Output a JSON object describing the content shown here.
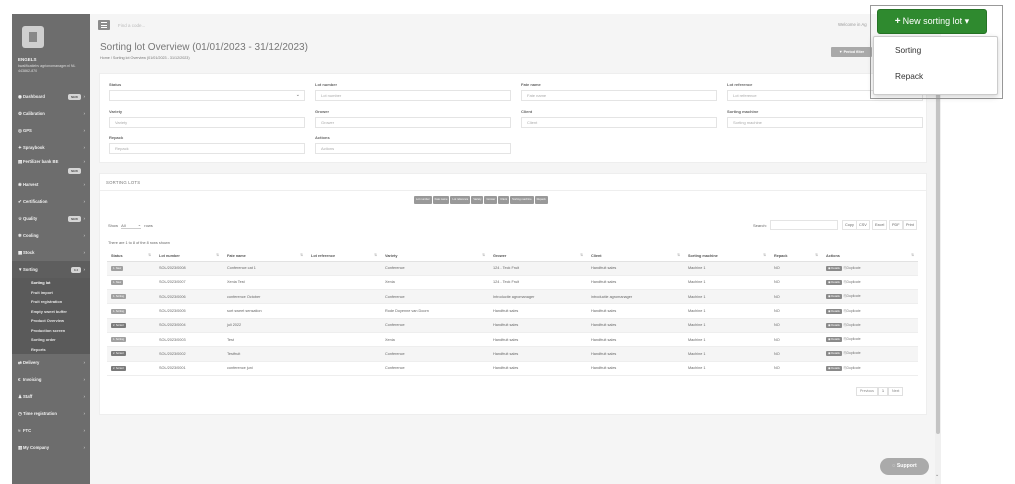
{
  "topbar": {
    "find_placeholder": "Find a code...",
    "welcome": "Welcome in Ag"
  },
  "sidebar": {
    "company": "ENGELS",
    "company_sub": "kwalificatiebv agrionomanager.nl NL 443862-870",
    "items": [
      {
        "icon": "dashboard-icon",
        "glyph": "◉",
        "label": "Dashboard",
        "badge": "NEW"
      },
      {
        "icon": "calibration-icon",
        "glyph": "⚙",
        "label": "Calibration",
        "badge": ""
      },
      {
        "icon": "gps-icon",
        "glyph": "◎",
        "label": "GPS",
        "badge": ""
      },
      {
        "icon": "sprayboek-icon",
        "glyph": "✦",
        "label": "Spraybook",
        "badge": ""
      },
      {
        "icon": "fertilizer-icon",
        "glyph": "▤",
        "label": "Fertilizer bank BE",
        "badge": "NEW"
      },
      {
        "icon": "harvest-icon",
        "glyph": "❀",
        "label": "Harvest",
        "badge": ""
      },
      {
        "icon": "certification-icon",
        "glyph": "✔",
        "label": "Certification",
        "badge": ""
      },
      {
        "icon": "quality-icon",
        "glyph": "☆",
        "label": "Quality",
        "badge": "NEW"
      },
      {
        "icon": "cooling-icon",
        "glyph": "❄",
        "label": "Cooling",
        "badge": ""
      },
      {
        "icon": "stock-icon",
        "glyph": "▦",
        "label": "Stock",
        "badge": ""
      },
      {
        "icon": "sorting-icon",
        "glyph": "▼",
        "label": "Sorting",
        "badge": "0.4"
      }
    ],
    "sorting_sub": [
      "Sorting lot",
      "Fruit import",
      "Fruit registration",
      "Empty sweet buffer",
      "Product Overview",
      "Production screen",
      "Sorting order",
      "Reports"
    ],
    "items_after": [
      {
        "icon": "delivery-icon",
        "glyph": "⇄",
        "label": "Delivery"
      },
      {
        "icon": "invoicing-icon",
        "glyph": "€",
        "label": "Invoicing"
      },
      {
        "icon": "staff-icon",
        "glyph": "♟",
        "label": "Staff"
      },
      {
        "icon": "time-registration-icon",
        "glyph": "◷",
        "label": "Time registration"
      },
      {
        "icon": "ftc-icon",
        "glyph": "≈",
        "label": "FTC"
      },
      {
        "icon": "company-icon",
        "glyph": "▥",
        "label": "My Company"
      }
    ]
  },
  "page": {
    "title": "Sorting lot Overview (01/01/2023 - 31/12/2023)",
    "breadcrumb": "Home  /  Sorting lot Overview (01/01/2023 - 31/12/2023)",
    "pivot_label": "▼ Period filter"
  },
  "filters": [
    {
      "label": "Status",
      "placeholder": "",
      "dropdown": true
    },
    {
      "label": "Lot number",
      "placeholder": "Lot number",
      "dropdown": false
    },
    {
      "label": "Fate name",
      "placeholder": "Fate name",
      "dropdown": false
    },
    {
      "label": "Lot reference",
      "placeholder": "Lot reference",
      "dropdown": false
    },
    {
      "label": "Variety",
      "placeholder": "Variety",
      "dropdown": false
    },
    {
      "label": "Grower",
      "placeholder": "Grower",
      "dropdown": false
    },
    {
      "label": "Client",
      "placeholder": "Client",
      "dropdown": false
    },
    {
      "label": "Sorting machine",
      "placeholder": "Sorting machine",
      "dropdown": false
    },
    {
      "label": "Repack",
      "placeholder": "Repack",
      "dropdown": false
    },
    {
      "label": "Actions",
      "placeholder": "Actions",
      "dropdown": false
    }
  ],
  "lots": {
    "heading": "SORTING LOTS",
    "column_buttons": [
      "Lot number",
      "Fate name",
      "Lot reference",
      "Variety",
      "Grower",
      "Client",
      "Sorting machine",
      "Repack"
    ],
    "show_label": "Show",
    "show_value": "All",
    "rows_label": "rows",
    "search_label": "Search:",
    "export_buttons": [
      "Copy",
      "CSV",
      "Excel",
      "PDF",
      "Print"
    ],
    "showing": "There are 1 to 8 of the 8 rows shown",
    "columns": [
      "Status",
      "Lot number",
      "Fate name",
      "Lot reference",
      "Variety",
      "Grower",
      "Client",
      "Sorting machine",
      "Repack",
      "Actions"
    ],
    "rows": [
      {
        "status": "1. New",
        "lot": "SOL/2023/0008",
        "fate": "Conference cat 1",
        "ref": "",
        "variety": "Conference",
        "grower": "124 - Teck Fruit",
        "client": "Handfruit sales",
        "machine": "Machine 1",
        "repack": "NO"
      },
      {
        "status": "1. New",
        "lot": "SOL/2023/0007",
        "fate": "Xenia Test",
        "ref": "",
        "variety": "Xenia",
        "grower": "124 - Teck Fruit",
        "client": "Handfruit sales",
        "machine": "Machine 1",
        "repack": "NO"
      },
      {
        "status": "1. Sorting",
        "lot": "SOL/2023/0006",
        "fate": "conference October",
        "ref": "",
        "variety": "Conference",
        "grower": "Introductie agromanager",
        "client": "introductie agromanager",
        "machine": "Machine 1",
        "repack": "NO"
      },
      {
        "status": "1. Sorting",
        "lot": "SOL/2023/0005",
        "fate": "sort sweet sensation",
        "ref": "",
        "variety": "Rode Doyenne van Doorn",
        "grower": "Handfruit sales",
        "client": "Handfruit sales",
        "machine": "Machine 1",
        "repack": "NO"
      },
      {
        "status": "2. Sorted",
        "lot": "SOL/2023/0004",
        "fate": "juli 2022",
        "ref": "",
        "variety": "Conference",
        "grower": "Handfruit sales",
        "client": "Handfruit sales",
        "machine": "Machine 1",
        "repack": "NO"
      },
      {
        "status": "1. Sorting",
        "lot": "SOL/2023/0003",
        "fate": "Test",
        "ref": "",
        "variety": "Xenia",
        "grower": "Handfruit sales",
        "client": "Handfruit sales",
        "machine": "Machine 1",
        "repack": "NO"
      },
      {
        "status": "2. Sorted",
        "lot": "SOL/2023/0002",
        "fate": "Testfruit",
        "ref": "",
        "variety": "Conference",
        "grower": "Handfruit sales",
        "client": "Handfruit sales",
        "machine": "Machine 1",
        "repack": "NO"
      },
      {
        "status": "2. Sorted",
        "lot": "SOL/2023/0001",
        "fate": "conference juni",
        "ref": "",
        "variety": "Conference",
        "grower": "Handfruit sales",
        "client": "Handfruit sales",
        "machine": "Machine 1",
        "repack": "NO"
      }
    ],
    "details_label": "Details",
    "duplicate_label": "Duplicate",
    "pager": [
      "Previous",
      "1",
      "Next"
    ]
  },
  "support_label": "Support",
  "new_lot": {
    "label": "New sorting lot",
    "options": [
      "Sorting",
      "Repack"
    ]
  }
}
